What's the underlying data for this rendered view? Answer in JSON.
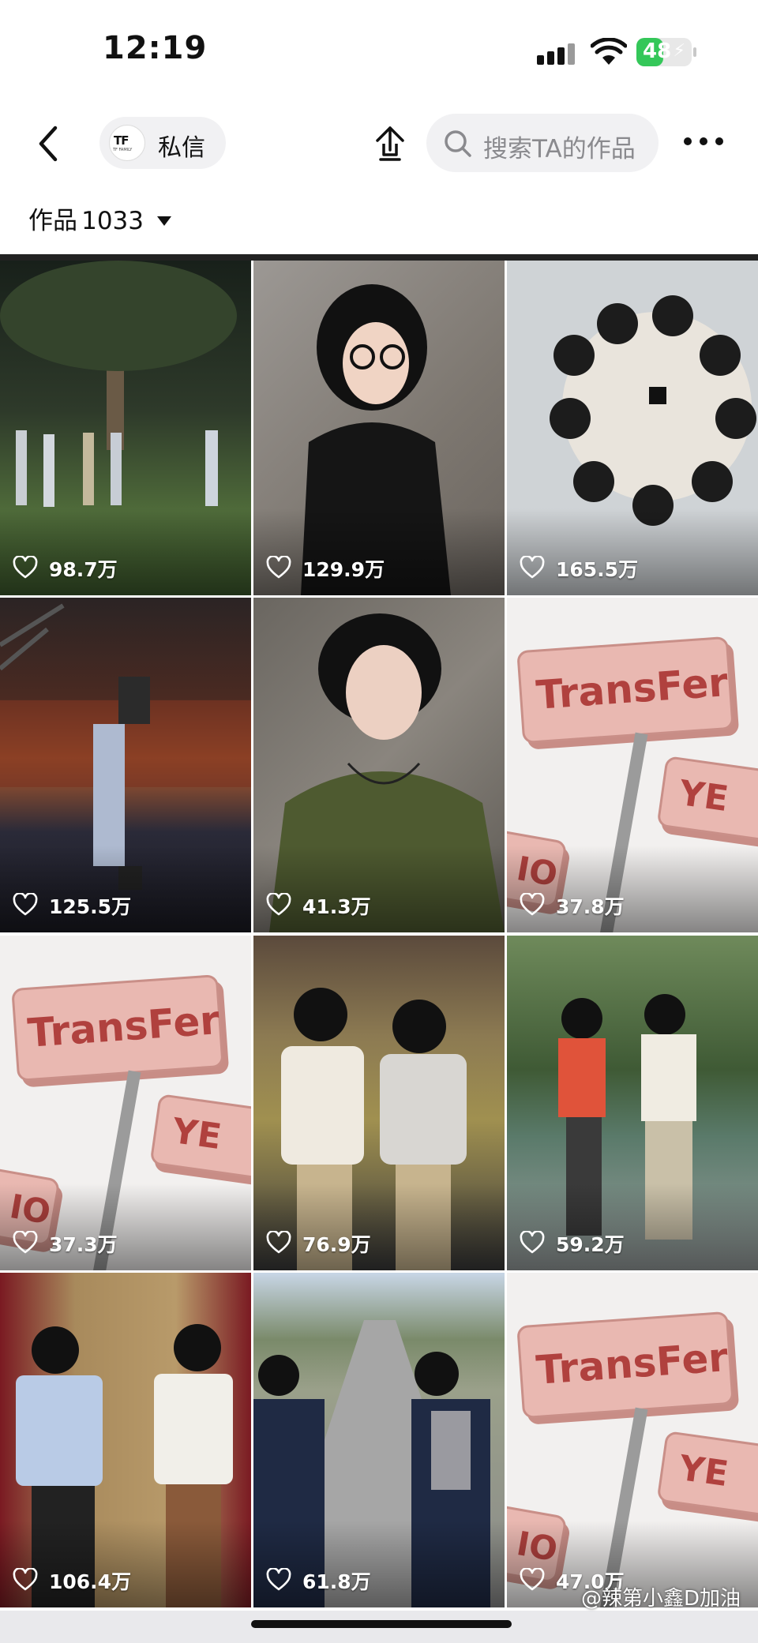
{
  "status_bar": {
    "time": "12:19",
    "battery": "48",
    "battery_level_percent": 48
  },
  "header": {
    "dm_label": "私信",
    "logo_mark": "TF",
    "logo_sub": "TF FAMILY",
    "search_placeholder": "搜索TA的作品"
  },
  "works": {
    "label": "作品",
    "count": "1033"
  },
  "videos": [
    {
      "likes": "98.7万"
    },
    {
      "likes": "129.9万"
    },
    {
      "likes": "165.5万"
    },
    {
      "likes": "125.5万"
    },
    {
      "likes": "41.3万"
    },
    {
      "likes": "37.8万"
    },
    {
      "likes": "37.3万"
    },
    {
      "likes": "76.9万"
    },
    {
      "likes": "59.2万"
    },
    {
      "likes": "106.4万"
    },
    {
      "likes": "61.8万"
    },
    {
      "likes": "47.0万"
    }
  ],
  "sign_text": "TransFer",
  "sign_small": "YE",
  "sign_small2": "IO",
  "watermark": "@辣第小鑫D加油",
  "colors": {
    "sign_pink": "#e9b8b1",
    "sign_text": "#b0413e",
    "battery_green": "#34c759",
    "search_bg": "#f1f1f3"
  }
}
